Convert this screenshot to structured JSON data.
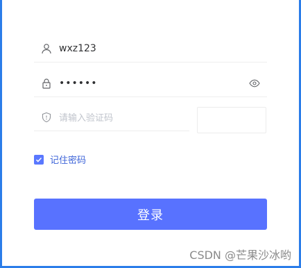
{
  "form": {
    "username": {
      "value": "wxz123",
      "icon": "user-icon"
    },
    "password": {
      "masked_value": "••••••",
      "icon": "lock-icon",
      "toggle_icon": "eye-icon"
    },
    "captcha": {
      "placeholder": "请输入验证码",
      "icon": "shield-icon"
    },
    "remember": {
      "label": "记住密码",
      "checked": true
    },
    "submit_label": "登录"
  },
  "watermark": "CSDN @芒果沙冰哟",
  "colors": {
    "accent": "#5872ff",
    "frame": "#2b7de9",
    "checkbox": "#5a78ff",
    "link_text": "#3c63d8"
  }
}
